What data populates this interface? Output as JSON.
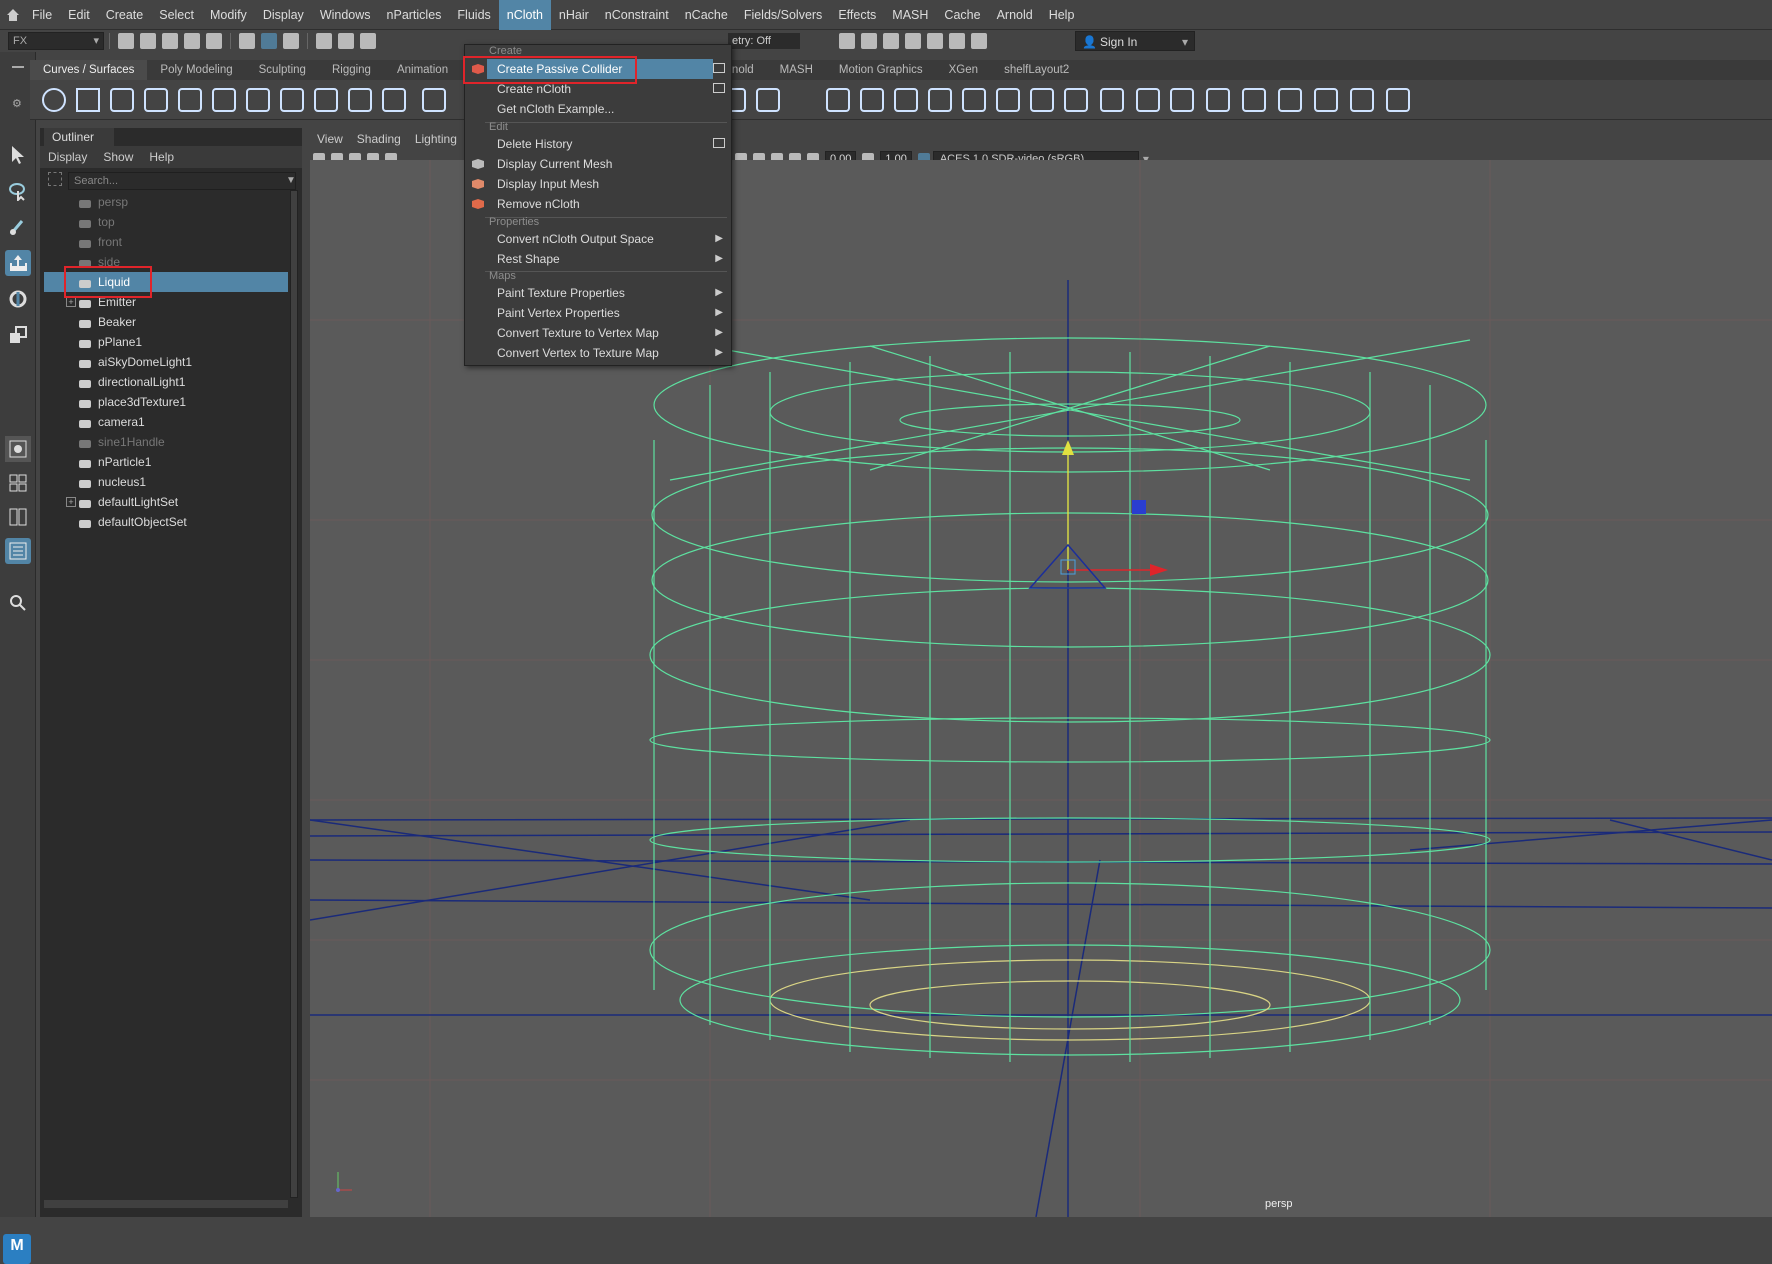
{
  "menubar": {
    "home_icon": "home-icon",
    "items": [
      "File",
      "Edit",
      "Create",
      "Select",
      "Modify",
      "Display",
      "Windows",
      "nParticles",
      "Fluids",
      "nCloth",
      "nHair",
      "nConstraint",
      "nCache",
      "Fields/Solvers",
      "Effects",
      "MASH",
      "Cache",
      "Arnold",
      "Help"
    ],
    "active": "nCloth"
  },
  "statusline": {
    "menuset": "FX",
    "symmetry": "etry: Off",
    "sign_in": "Sign In"
  },
  "shelf": {
    "tabs": [
      "Curves / Surfaces",
      "Poly Modeling",
      "Sculpting",
      "Rigging",
      "Animation",
      "rnold",
      "MASH",
      "Motion Graphics",
      "XGen",
      "shelfLayout2"
    ],
    "active_tab": "Curves / Surfaces"
  },
  "outliner": {
    "title": "Outliner",
    "menu": [
      "Display",
      "Show",
      "Help"
    ],
    "search_placeholder": "Search...",
    "items": [
      {
        "label": "persp",
        "dim": true,
        "icon": "camera-icon"
      },
      {
        "label": "top",
        "dim": true,
        "icon": "camera-icon"
      },
      {
        "label": "front",
        "dim": true,
        "icon": "camera-icon"
      },
      {
        "label": "side",
        "dim": true,
        "icon": "camera-icon"
      },
      {
        "label": "Liquid",
        "selected": true,
        "icon": "mesh-icon"
      },
      {
        "label": "Emitter",
        "expandable": true,
        "icon": "mesh-icon"
      },
      {
        "label": "Beaker",
        "icon": "mesh-icon"
      },
      {
        "label": "pPlane1",
        "icon": "mesh-icon"
      },
      {
        "label": "aiSkyDomeLight1",
        "icon": "skydome-icon"
      },
      {
        "label": "directionalLight1",
        "icon": "directional-light-icon"
      },
      {
        "label": "place3dTexture1",
        "icon": "texture-placement-icon"
      },
      {
        "label": "camera1",
        "icon": "camera-icon"
      },
      {
        "label": "sine1Handle",
        "dim": true,
        "icon": "deformer-handle-icon"
      },
      {
        "label": "nParticle1",
        "icon": "particle-icon"
      },
      {
        "label": "nucleus1",
        "icon": "nucleus-icon"
      },
      {
        "label": "defaultLightSet",
        "expandable": true,
        "icon": "set-icon"
      },
      {
        "label": "defaultObjectSet",
        "icon": "set-icon"
      }
    ]
  },
  "viewport": {
    "menu": [
      "View",
      "Shading",
      "Lighting"
    ],
    "field_a": "0.00",
    "field_b": "1.00",
    "colorspace": "ACES 1.0 SDR-video (sRGB)",
    "camera_label": "persp"
  },
  "ncloth_menu": {
    "sections": {
      "create": "Create",
      "edit": "Edit",
      "properties": "Properties",
      "maps": "Maps"
    },
    "items": {
      "create_passive_collider": "Create Passive Collider",
      "create_ncloth": "Create nCloth",
      "get_example": "Get nCloth Example...",
      "delete_history": "Delete History",
      "display_current_mesh": "Display Current Mesh",
      "display_input_mesh": "Display Input Mesh",
      "remove_ncloth": "Remove nCloth",
      "convert_output_space": "Convert nCloth Output Space",
      "rest_shape": "Rest Shape",
      "paint_texture": "Paint Texture Properties",
      "paint_vertex": "Paint Vertex Properties",
      "tex_to_vertex": "Convert Texture to Vertex Map",
      "vertex_to_tex": "Convert Vertex to Texture Map"
    },
    "highlighted": "Create Passive Collider"
  },
  "colors": {
    "accent": "#5285a6",
    "wire": "#5ef0a8",
    "annotation": "#e0242a",
    "grid": "#1a2a7a"
  },
  "logo_text": "M"
}
